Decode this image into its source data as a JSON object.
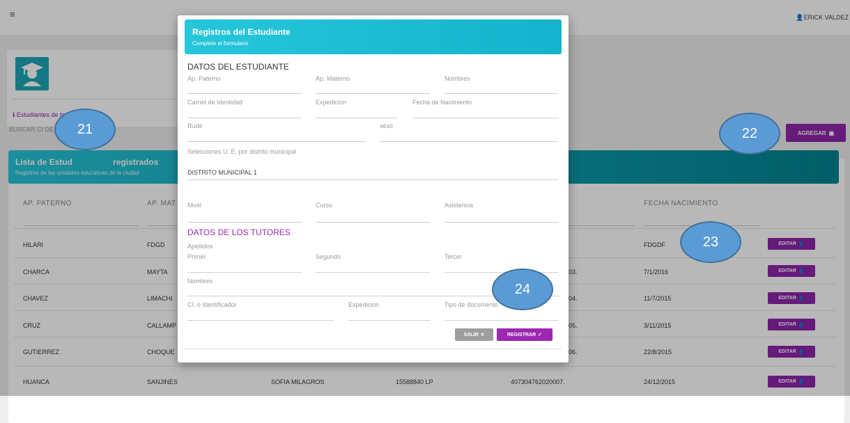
{
  "topbar": {
    "menu_icon": "hamburger-icon",
    "user_icon": "user-icon",
    "user_name": "ERICK VALDEZ"
  },
  "info_card": {
    "link_icon": "info-icon",
    "link_text": "Estudiantes de todas las U.E."
  },
  "search": {
    "label": "BUSCAR CI DE"
  },
  "add_button": {
    "label": "AGREGAR",
    "icon": "folder-plus-icon"
  },
  "list": {
    "title": "Lista de Estud",
    "title_end": "registrados",
    "subtitle": "Registros de las unidades educativas de la ciudad",
    "columns": [
      "AP. PATERNO",
      "AP. MAT",
      "FECHA NACIMIENTO"
    ],
    "rows": [
      {
        "paterno": "HILARI",
        "materno": "FDGD",
        "nombres": "",
        "ci": "",
        "rude": "",
        "fecha": "FDGDF"
      },
      {
        "paterno": "CHARCA",
        "materno": "MAYTA",
        "nombres": "",
        "ci": "",
        "rude": "03.",
        "fecha": "7/1/2016"
      },
      {
        "paterno": "CHAVEZ",
        "materno": "LIMACHI",
        "nombres": "",
        "ci": "",
        "rude": "04.",
        "fecha": "11/7/2015"
      },
      {
        "paterno": "CRUZ",
        "materno": "CALLAMP",
        "nombres": "",
        "ci": "",
        "rude": "05.",
        "fecha": "3/11/2015"
      },
      {
        "paterno": "GUTIERREZ",
        "materno": "CHOQUE",
        "nombres": "",
        "ci": "",
        "rude": "06.",
        "fecha": "22/8/2015"
      },
      {
        "paterno": "HUANCA",
        "materno": "SANJINES",
        "nombres": "SOFIA MILAGROS",
        "ci": "15588840 LP",
        "rude": "407304762020007.",
        "fecha": "24/12/2015"
      }
    ],
    "edit_label": "EDITAR",
    "edit_icon": "user-edit-icon"
  },
  "modal": {
    "title": "Registros del Estudiante",
    "subtitle": "Complete el formulario",
    "student_section": "DATOS DEL ESTUDIANTE",
    "ap_paterno": "Ap. Paterno",
    "ap_materno": "Ap. Materno",
    "nombres": "Nombres",
    "carnet": "Carnet de Identidad",
    "expedicion": "Expedicion",
    "fecha_nac": "Fecha de Nacimiento",
    "rude": "Rude",
    "sexo": "sexo",
    "select_label": "Selecciones U. E. por distrito municipal",
    "distrito_value": "DISTRITO MUNICIPAL 1",
    "nivel": "Nivel",
    "curso": "Curso",
    "asistencia": "Asistencia",
    "tutor_section": "DATOS DE LOS TUTORES",
    "apellidos": "Apellidos",
    "primer": "Primer",
    "segundo": "Segundo",
    "tercer": "Tercer",
    "tutor_nombres": "Nombres",
    "ci_ident": "CI. o Identificador",
    "tutor_expedicion": "Expedicion",
    "tipo_doc": "Tipo de documento",
    "salir_label": "SALIR",
    "salir_icon": "close-icon",
    "registrar_label": "REGISTRAR",
    "registrar_icon": "check-icon"
  },
  "callouts": [
    "21",
    "22",
    "23",
    "24"
  ],
  "colors": {
    "accent": "#8e24aa",
    "header_teal": "#26c6da",
    "callout": "#5b9bd5"
  }
}
